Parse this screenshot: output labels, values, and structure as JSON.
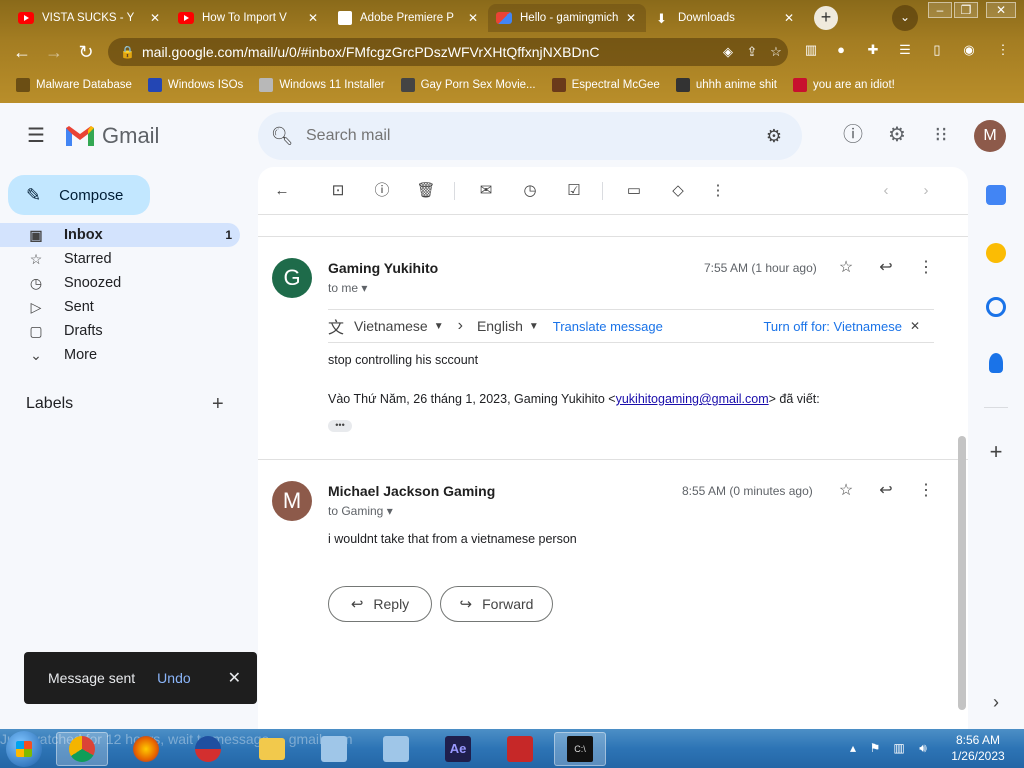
{
  "browser": {
    "tabs": [
      {
        "title": "VISTA SUCKS - Y",
        "favicon": "youtube-icon"
      },
      {
        "title": "How To Import V",
        "favicon": "youtube-icon"
      },
      {
        "title": "Adobe Premiere P",
        "favicon": "bank-icon"
      },
      {
        "title": "Hello - gamingmich",
        "favicon": "gmail-icon"
      },
      {
        "title": "Downloads",
        "favicon": "download-icon"
      }
    ],
    "url": "mail.google.com/mail/u/0/#inbox/FMfcgzGrcPDszWFVrXHtQffxnjNXBDnC",
    "bookmarks": [
      {
        "label": "Malware Database",
        "color": "#6b4e14"
      },
      {
        "label": "Windows ISOs",
        "color": "#2346b4"
      },
      {
        "label": "Windows 11 Installer",
        "color": "#b8b8b8"
      },
      {
        "label": "Gay Porn Sex Movie...",
        "color": "#444444"
      },
      {
        "label": "Espectral McGee",
        "color": "#6a3a1a"
      },
      {
        "label": "uhhh anime shit",
        "color": "#333333"
      },
      {
        "label": "you are an idiot!",
        "color": "#c8102e"
      }
    ]
  },
  "gmail": {
    "logo_text": "Gmail",
    "search_placeholder": "Search mail",
    "account_initial": "M",
    "compose_label": "Compose",
    "nav": [
      {
        "label": "Inbox",
        "count": "1",
        "icon": "inbox-icon",
        "active": true
      },
      {
        "label": "Starred",
        "icon": "star-icon"
      },
      {
        "label": "Snoozed",
        "icon": "clock-icon"
      },
      {
        "label": "Sent",
        "icon": "send-icon"
      },
      {
        "label": "Drafts",
        "icon": "draft-icon"
      },
      {
        "label": "More",
        "icon": "chevron-down-icon"
      }
    ],
    "labels_title": "Labels",
    "messages": [
      {
        "avatar": "G",
        "avatar_color": "#1e6b4a",
        "sender": "Gaming Yukihito",
        "to": "to me",
        "time": "7:55 AM (1 hour ago)",
        "translate": {
          "from": "Vietnamese",
          "to": "English",
          "action": "Translate message",
          "turn_off": "Turn off for: Vietnamese"
        },
        "body": "stop controlling his sccount",
        "quote_prefix": "Vào Thứ Năm, 26 tháng 1, 2023, Gaming Yukihito <",
        "quote_email": "yukihitogaming@gmail.com",
        "quote_suffix": "> đã viết:"
      },
      {
        "avatar": "M",
        "avatar_color": "#8d5a4a",
        "sender": "Michael Jackson Gaming",
        "to": "to Gaming",
        "time": "8:55 AM (0 minutes ago)",
        "body": "i wouldnt take that from a vietnamese person"
      }
    ],
    "reply_label": "Reply",
    "forward_label": "Forward",
    "toast": {
      "text": "Message sent",
      "undo": "Undo"
    }
  },
  "taskbar": {
    "watermark": "Just watched for 12 hours, wait to message ... gmail.com",
    "time": "8:56 AM",
    "date": "1/26/2023"
  }
}
